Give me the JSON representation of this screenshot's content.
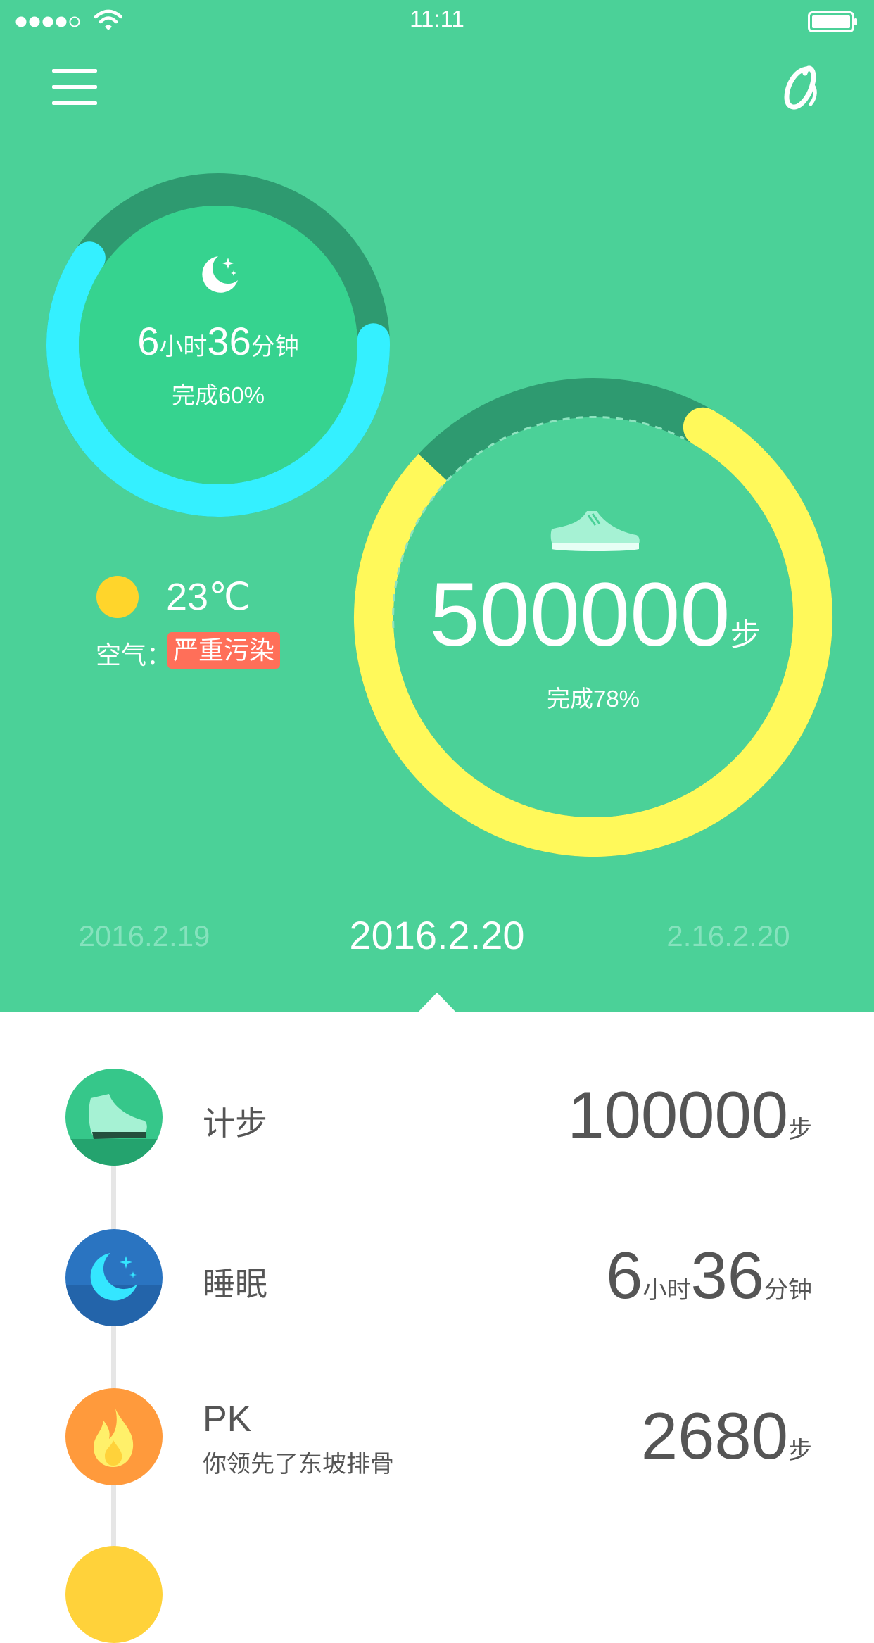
{
  "status_bar": {
    "time": "11:11"
  },
  "sleep": {
    "hours": "6",
    "hours_unit": "小时",
    "minutes": "36",
    "minutes_unit": "分钟",
    "completion_text": "完成60%",
    "progress": 0.6,
    "colors": {
      "track": "#2e9a70",
      "fill": "#34f0ff",
      "inner": "#36d38f"
    }
  },
  "weather": {
    "temperature": "23℃",
    "air_label": "空气：",
    "air_quality": "严重污染",
    "air_quality_color": "#ff6f59",
    "sun_color": "#ffd52b"
  },
  "steps": {
    "value": "500000",
    "unit": "步",
    "completion_text": "完成78%",
    "progress": 0.78,
    "colors": {
      "track": "#2e9a70",
      "fill": "#fff95a"
    }
  },
  "dates": {
    "prev": "2016.2.19",
    "current": "2016.2.20",
    "next": "2.16.2.20"
  },
  "list": {
    "step": {
      "label": "计步",
      "value": "100000",
      "unit": "步"
    },
    "sleep": {
      "label": "睡眠",
      "hours": "6",
      "hours_unit": "小时",
      "minutes": "36",
      "minutes_unit": "分钟"
    },
    "pk": {
      "title": "PK",
      "subtitle": "你领先了东坡排骨",
      "value": "2680",
      "unit": "步"
    }
  },
  "icons": [
    "signal-dots-icon",
    "wifi-icon",
    "battery-icon",
    "menu-icon",
    "logo-icon",
    "moon-icon",
    "shoe-icon",
    "sun-icon",
    "flame-icon"
  ]
}
